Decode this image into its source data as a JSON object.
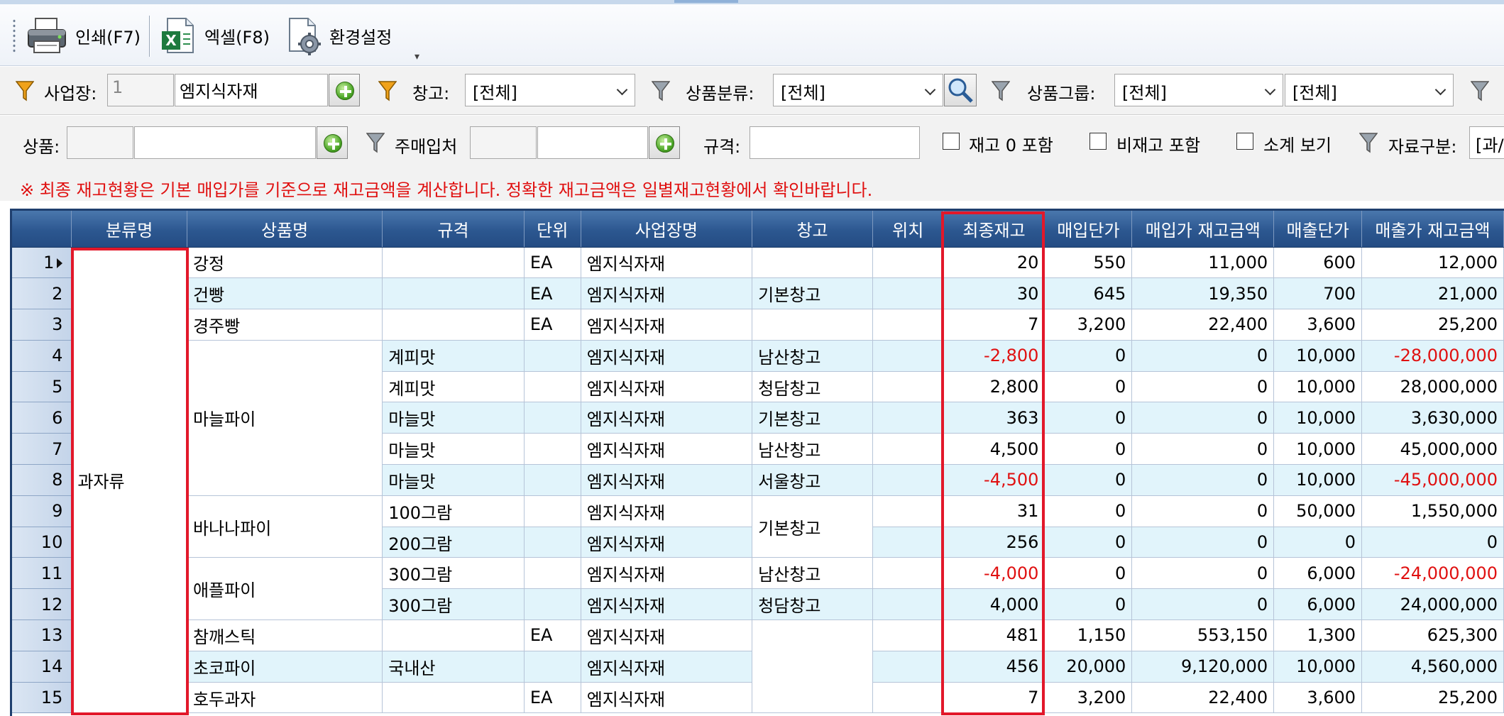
{
  "toolbar": {
    "print_label": "인쇄(F7)",
    "excel_label": "엑셀(F8)",
    "settings_label": "환경설정"
  },
  "filters": {
    "site_label": "사업장:",
    "site_code": "1",
    "site_name": "엠지식자재",
    "warehouse_label": "창고:",
    "warehouse_value": "[전체]",
    "category_label": "상품분류:",
    "category_value": "[전체]",
    "group_label": "상품그룹:",
    "group_value1": "[전체]",
    "group_value2": "[전체]",
    "product_label": "상품:",
    "product_code": "",
    "product_name": "",
    "supplier_label": "주매입처",
    "supplier_code": "",
    "supplier_name": "",
    "spec_label": "규격:",
    "spec_value": "",
    "chk_zero_stock": "재고 0 포함",
    "chk_non_stock": "비재고 포함",
    "chk_subtotal": "소계 보기",
    "data_type_label": "자료구분:",
    "data_type_value": "[과/"
  },
  "notice": "※ 최종 재고현황은 기본 매입가를 기준으로 재고금액을 계산합니다. 정확한 재고금액은 일별재고현황에서 확인바랍니다.",
  "grid": {
    "columns": [
      "분류명",
      "상품명",
      "규격",
      "단위",
      "사업장명",
      "창고",
      "위치",
      "최종재고",
      "매입단가",
      "매입가 재고금액",
      "매출단가",
      "매출가 재고금액"
    ],
    "category_merged": "과자류",
    "product_groups": [
      {
        "name": "강정",
        "rows": 1
      },
      {
        "name": "건빵",
        "rows": 1
      },
      {
        "name": "경주빵",
        "rows": 1
      },
      {
        "name": "마늘파이",
        "rows": 5
      },
      {
        "name": "바나나파이",
        "rows": 2
      },
      {
        "name": "애플파이",
        "rows": 2
      },
      {
        "name": "참깨스틱",
        "rows": 1
      },
      {
        "name": "초코파이",
        "rows": 1
      },
      {
        "name": "호두과자",
        "rows": 1
      }
    ],
    "warehouse_groups": [
      {
        "name": "",
        "rows": 1
      },
      {
        "name": "기본창고",
        "rows": 1
      },
      {
        "name": "",
        "rows": 1
      },
      {
        "name": "남산창고",
        "rows": 1
      },
      {
        "name": "청담창고",
        "rows": 1
      },
      {
        "name": "기본창고",
        "rows": 1
      },
      {
        "name": "남산창고",
        "rows": 1
      },
      {
        "name": "서울창고",
        "rows": 1
      },
      {
        "name": "기본창고",
        "rows": 2
      },
      {
        "name": "남산창고",
        "rows": 1
      },
      {
        "name": "청담창고",
        "rows": 1
      },
      {
        "name": "",
        "rows": 3
      }
    ],
    "rows": [
      {
        "no": "1",
        "spec": "",
        "unit": "EA",
        "site": "엠지식자재",
        "loc": "",
        "stock": "20",
        "buy_price": "550",
        "buy_amount": "11,000",
        "sell_price": "600",
        "sell_amount": "12,000"
      },
      {
        "no": "2",
        "spec": "",
        "unit": "EA",
        "site": "엠지식자재",
        "loc": "",
        "stock": "30",
        "buy_price": "645",
        "buy_amount": "19,350",
        "sell_price": "700",
        "sell_amount": "21,000"
      },
      {
        "no": "3",
        "spec": "",
        "unit": "EA",
        "site": "엠지식자재",
        "loc": "",
        "stock": "7",
        "buy_price": "3,200",
        "buy_amount": "22,400",
        "sell_price": "3,600",
        "sell_amount": "25,200"
      },
      {
        "no": "4",
        "spec": "계피맛",
        "unit": "",
        "site": "엠지식자재",
        "loc": "",
        "stock": "-2,800",
        "buy_price": "0",
        "buy_amount": "0",
        "sell_price": "10,000",
        "sell_amount": "-28,000,000"
      },
      {
        "no": "5",
        "spec": "계피맛",
        "unit": "",
        "site": "엠지식자재",
        "loc": "",
        "stock": "2,800",
        "buy_price": "0",
        "buy_amount": "0",
        "sell_price": "10,000",
        "sell_amount": "28,000,000"
      },
      {
        "no": "6",
        "spec": "마늘맛",
        "unit": "",
        "site": "엠지식자재",
        "loc": "",
        "stock": "363",
        "buy_price": "0",
        "buy_amount": "0",
        "sell_price": "10,000",
        "sell_amount": "3,630,000"
      },
      {
        "no": "7",
        "spec": "마늘맛",
        "unit": "",
        "site": "엠지식자재",
        "loc": "",
        "stock": "4,500",
        "buy_price": "0",
        "buy_amount": "0",
        "sell_price": "10,000",
        "sell_amount": "45,000,000"
      },
      {
        "no": "8",
        "spec": "마늘맛",
        "unit": "",
        "site": "엠지식자재",
        "loc": "",
        "stock": "-4,500",
        "buy_price": "0",
        "buy_amount": "0",
        "sell_price": "10,000",
        "sell_amount": "-45,000,000"
      },
      {
        "no": "9",
        "spec": "100그람",
        "unit": "",
        "site": "엠지식자재",
        "loc": "",
        "stock": "31",
        "buy_price": "0",
        "buy_amount": "0",
        "sell_price": "50,000",
        "sell_amount": "1,550,000"
      },
      {
        "no": "10",
        "spec": "200그람",
        "unit": "",
        "site": "엠지식자재",
        "loc": "",
        "stock": "256",
        "buy_price": "0",
        "buy_amount": "0",
        "sell_price": "0",
        "sell_amount": "0"
      },
      {
        "no": "11",
        "spec": "300그람",
        "unit": "",
        "site": "엠지식자재",
        "loc": "",
        "stock": "-4,000",
        "buy_price": "0",
        "buy_amount": "0",
        "sell_price": "6,000",
        "sell_amount": "-24,000,000"
      },
      {
        "no": "12",
        "spec": "300그람",
        "unit": "",
        "site": "엠지식자재",
        "loc": "",
        "stock": "4,000",
        "buy_price": "0",
        "buy_amount": "0",
        "sell_price": "6,000",
        "sell_amount": "24,000,000"
      },
      {
        "no": "13",
        "spec": "",
        "unit": "EA",
        "site": "엠지식자재",
        "loc": "",
        "stock": "481",
        "buy_price": "1,150",
        "buy_amount": "553,150",
        "sell_price": "1,300",
        "sell_amount": "625,300"
      },
      {
        "no": "14",
        "spec": "국내산",
        "unit": "",
        "site": "엠지식자재",
        "loc": "",
        "stock": "456",
        "buy_price": "20,000",
        "buy_amount": "9,120,000",
        "sell_price": "10,000",
        "sell_amount": "4,560,000"
      },
      {
        "no": "15",
        "spec": "",
        "unit": "EA",
        "site": "엠지식자재",
        "loc": "",
        "stock": "7",
        "buy_price": "3,200",
        "buy_amount": "22,400",
        "sell_price": "3,600",
        "sell_amount": "25,200"
      }
    ]
  },
  "colors": {
    "header_blue": "#2c5790",
    "alt_row": "#e1f4fb",
    "negative_red": "#e01010",
    "highlight_red": "#e2182a"
  }
}
